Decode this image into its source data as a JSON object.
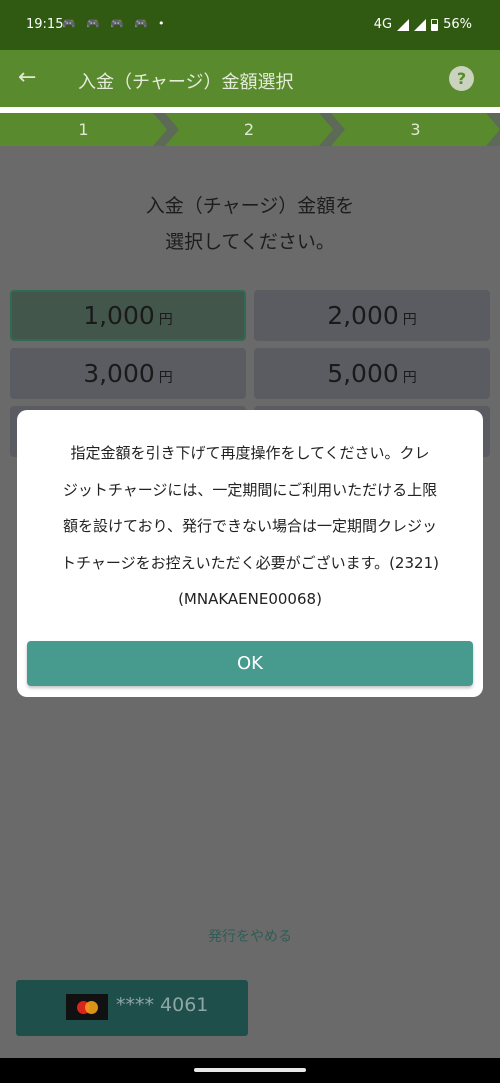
{
  "status_bar": {
    "time": "19:15",
    "notifications": [
      "🎮",
      "🎮",
      "🎮",
      "🎮",
      "•"
    ],
    "network": "4G",
    "battery": "56%"
  },
  "app_bar": {
    "back_icon": "arrow-left",
    "title": "入金（チャージ）金額選択",
    "help_label": "?"
  },
  "stepper": {
    "steps": [
      "1",
      "2",
      "3"
    ],
    "active_index": 0
  },
  "main": {
    "prompt_line1": "入金（チャージ）金額を",
    "prompt_line2": "選択してください。",
    "amounts": [
      {
        "value": "1,000",
        "unit": "円",
        "selected": true
      },
      {
        "value": "2,000",
        "unit": "円",
        "selected": false
      },
      {
        "value": "3,000",
        "unit": "円",
        "selected": false
      },
      {
        "value": "5,000",
        "unit": "円",
        "selected": false
      }
    ],
    "cancel_link": "発行をやめる",
    "card": {
      "brand": "mastercard",
      "masked_number": "**** 4061"
    }
  },
  "dialog": {
    "lines": [
      "指定金額を引き下げて再度操作をしてください。クレ",
      "ジットチャージには、一定期間にご利用いただける上限",
      "額を設けており、発行できない場合は一定期間クレジッ",
      "トチャージをお控えいただく必要がございます。(2321)",
      "(MNAKAENE00068)"
    ],
    "ok_label": "OK"
  },
  "colors": {
    "status_bar": "#305a12",
    "app_bar": "#5a8a2e",
    "overlay_bg": "#6a6a6a",
    "ok_button": "#469a8e"
  }
}
